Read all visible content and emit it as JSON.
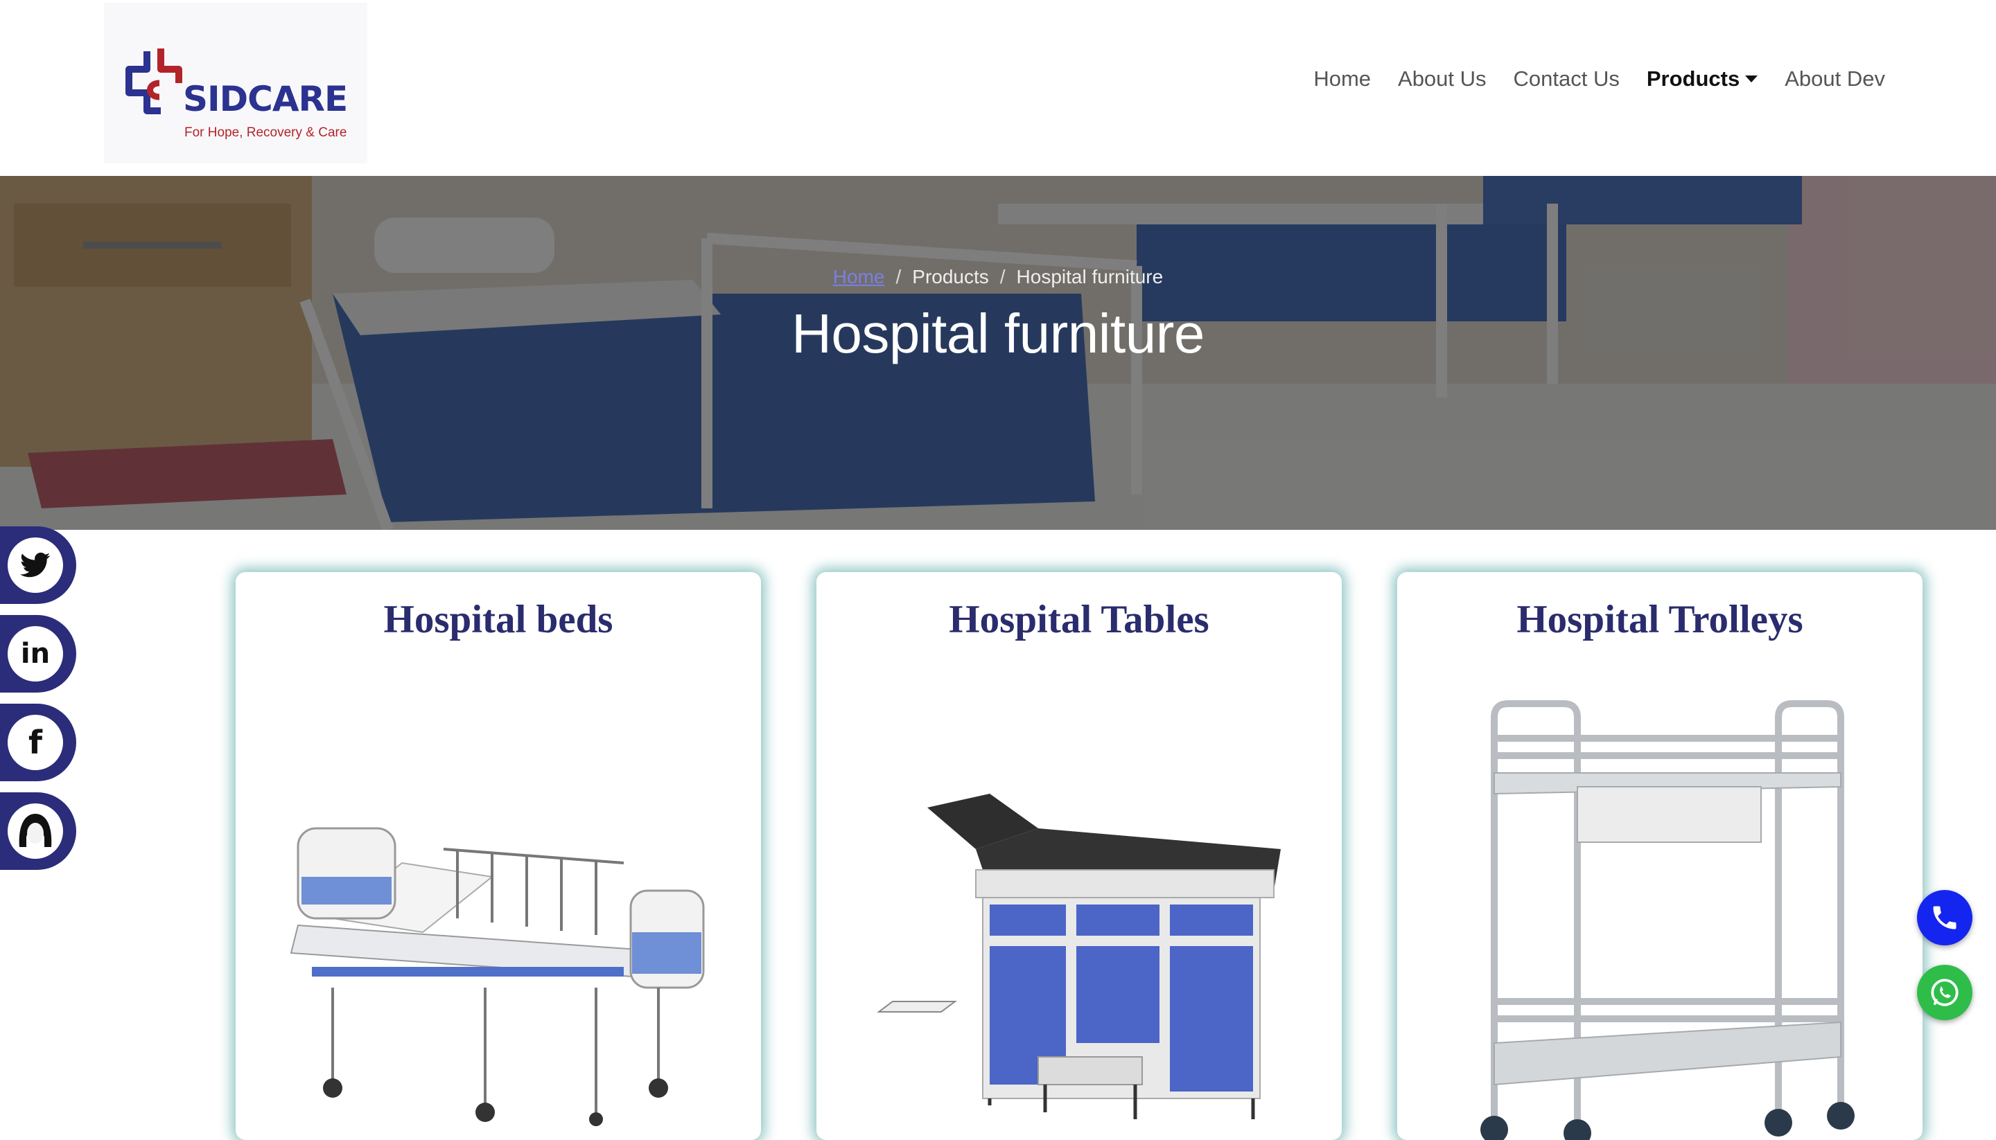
{
  "brand": {
    "name": "SIDCARE",
    "tagline": "For Hope, Recovery & Care"
  },
  "nav": {
    "items": [
      {
        "label": "Home"
      },
      {
        "label": "About Us"
      },
      {
        "label": "Contact Us"
      },
      {
        "label": "Products",
        "active": true,
        "dropdown": true
      },
      {
        "label": "About Dev"
      }
    ]
  },
  "hero": {
    "breadcrumb": [
      "Home",
      "Products",
      "Hospital furniture"
    ],
    "title": "Hospital furniture"
  },
  "social": [
    {
      "icon": "twitter-icon"
    },
    {
      "icon": "linkedin-icon"
    },
    {
      "icon": "facebook-icon"
    },
    {
      "icon": "developer-avatar-icon"
    }
  ],
  "cards": [
    {
      "title": "Hospital beds"
    },
    {
      "title": "Hospital Tables"
    },
    {
      "title": "Hospital Trolleys"
    }
  ],
  "floating": {
    "phone_icon": "phone-icon",
    "whatsapp_icon": "whatsapp-icon"
  },
  "colors": {
    "brand_navy": "#2b3290",
    "brand_red": "#b3242a",
    "social_bg": "#2b2c7a",
    "card_heading": "#2a2c6e",
    "card_glow": "#108080",
    "phone_button": "#1525f0",
    "whatsapp_button": "#2fbd4a"
  }
}
